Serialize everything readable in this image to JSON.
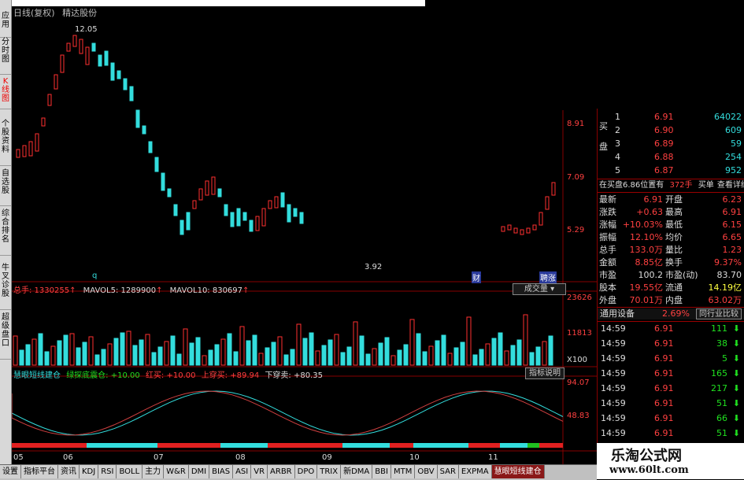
{
  "chart_header": {
    "title": "日线(复权)",
    "stock_name": "精达股份"
  },
  "left_nav": [
    {
      "label": "应用"
    },
    {
      "label": "分时图"
    },
    {
      "label": "K线图"
    },
    {
      "label": "个股资料"
    },
    {
      "label": "自选股"
    },
    {
      "label": "综合排名"
    },
    {
      "label": "牛叉诊股"
    },
    {
      "label": "超级盘口"
    }
  ],
  "price_labels": {
    "high_marker": "12.05",
    "low_marker": "3.92",
    "axis": [
      "8.91",
      "7.09",
      "5.29"
    ],
    "event_q": "q",
    "event_cai": "财",
    "event_zhang": "聘涨"
  },
  "volume_panel": {
    "total_label": "总手: 1330255",
    "mavol5": "MAVOL5: 1289900",
    "mavol10": "MAVOL10: 830697",
    "selector": "成交量",
    "axis": [
      "23626",
      "11813",
      "X100"
    ]
  },
  "indicator_panel": {
    "name": "慧眼短线建仓",
    "item1": "绿探底震仓: +10.00",
    "item2": "红买: +10.00",
    "item3": "上穿买: +89.94",
    "item4": "下穿卖: +80.35",
    "button": "指标说明",
    "axis": [
      "94.07",
      "48.83"
    ]
  },
  "date_axis": [
    "05",
    "06",
    "07",
    "08",
    "09",
    "10",
    "11"
  ],
  "order_book": {
    "buy_label": "买盘",
    "rows": [
      {
        "level": "1",
        "price": "6.91",
        "volume": "64022"
      },
      {
        "level": "2",
        "price": "6.90",
        "volume": "609"
      },
      {
        "level": "3",
        "price": "6.89",
        "volume": "59"
      },
      {
        "level": "4",
        "price": "6.88",
        "volume": "254"
      },
      {
        "level": "5",
        "price": "6.87",
        "volume": "952"
      }
    ],
    "position_text": "在买盘6.86位置有",
    "position_qty": "372手",
    "buy_btn": "买单",
    "detail_btn": "查看详细"
  },
  "quote": [
    {
      "l1": "最新",
      "v1": "6.91",
      "l2": "开盘",
      "v2": "6.23"
    },
    {
      "l1": "涨跌",
      "v1": "+0.63",
      "l2": "最高",
      "v2": "6.91"
    },
    {
      "l1": "涨幅",
      "v1": "+10.03%",
      "l2": "最低",
      "v2": "6.15"
    },
    {
      "l1": "振幅",
      "v1": "12.10%",
      "l2": "均价",
      "v2": "6.65"
    },
    {
      "l1": "总手",
      "v1": "133.0万",
      "l2": "量比",
      "v2": "1.23"
    },
    {
      "l1": "金额",
      "v1": "8.85亿",
      "l2": "换手",
      "v2": "9.37%"
    },
    {
      "l1": "市盈",
      "v1": "100.2",
      "l2": "市盈(动)",
      "v2": "83.70"
    },
    {
      "l1": "股本",
      "v1": "19.55亿",
      "l2": "流通",
      "v2": "14.19亿"
    },
    {
      "l1": "外盘",
      "v1": "70.01万",
      "l2": "内盘",
      "v2": "63.02万"
    }
  ],
  "sector": {
    "name": "通用设备",
    "change": "2.69%",
    "compare": "同行业比较"
  },
  "trades": [
    {
      "time": "14:59",
      "price": "6.91",
      "vol": "111",
      "dir": "down"
    },
    {
      "time": "14:59",
      "price": "6.91",
      "vol": "38",
      "dir": "down"
    },
    {
      "time": "14:59",
      "price": "6.91",
      "vol": "5",
      "dir": "down"
    },
    {
      "time": "14:59",
      "price": "6.91",
      "vol": "165",
      "dir": "down"
    },
    {
      "time": "14:59",
      "price": "6.91",
      "vol": "217",
      "dir": "down"
    },
    {
      "time": "14:59",
      "price": "6.91",
      "vol": "51",
      "dir": "down"
    },
    {
      "time": "14:59",
      "price": "6.91",
      "vol": "66",
      "dir": "down"
    },
    {
      "time": "14:59",
      "price": "6.91",
      "vol": "51",
      "dir": "down"
    }
  ],
  "tabs": [
    "设置",
    "指标平台",
    "资讯",
    "KDJ",
    "RSI",
    "BOLL",
    "主力",
    "W&R",
    "DMI",
    "BIAS",
    "ASI",
    "VR",
    "ARBR",
    "DPO",
    "TRIX",
    "新DMA",
    "BBI",
    "MTM",
    "OBV",
    "SAR",
    "EXPMA",
    "慧眼短线建仓"
  ],
  "watermark": {
    "line1": "乐淘公式网",
    "line2": "www.60lt.com"
  },
  "colors": {
    "up": "#ff3030",
    "down": "#33dddd",
    "bg": "#000000",
    "grid": "#800000"
  }
}
